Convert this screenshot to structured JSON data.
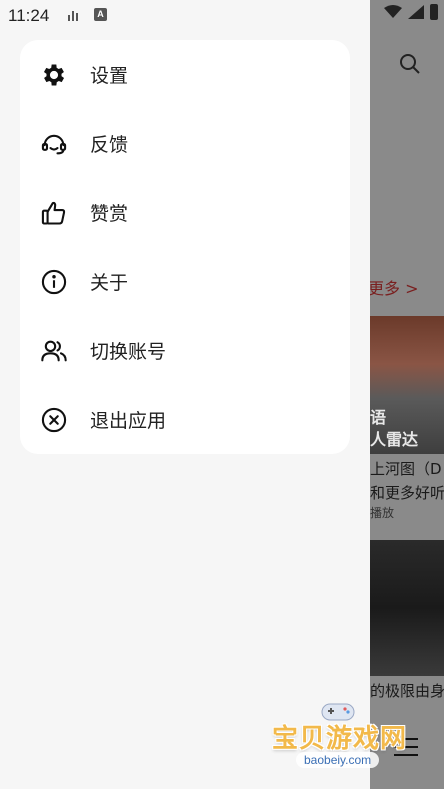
{
  "status_bar": {
    "time": "11:24",
    "a_icon_text": "A"
  },
  "menu": {
    "items": [
      {
        "label": "设置",
        "icon": "gear-icon"
      },
      {
        "label": "反馈",
        "icon": "headset-icon"
      },
      {
        "label": "赞赏",
        "icon": "thumbs-up-icon"
      },
      {
        "label": "关于",
        "icon": "info-icon"
      },
      {
        "label": "切换账号",
        "icon": "users-icon"
      },
      {
        "label": "退出应用",
        "icon": "close-circle-icon"
      }
    ]
  },
  "background": {
    "more_link": "更多 >",
    "thumb1_line1": "语",
    "thumb1_line2": "人雷达",
    "caption1": "上河图（D",
    "caption2": "和更多好听",
    "caption3": "播放",
    "caption4": "的极限由身"
  },
  "watermark": {
    "title": "宝贝游戏网",
    "url": "baobeiy.com"
  },
  "colors": {
    "drawer_bg": "#f6f6f6",
    "card_bg": "#ffffff",
    "accent_more": "#7a1f1f"
  }
}
